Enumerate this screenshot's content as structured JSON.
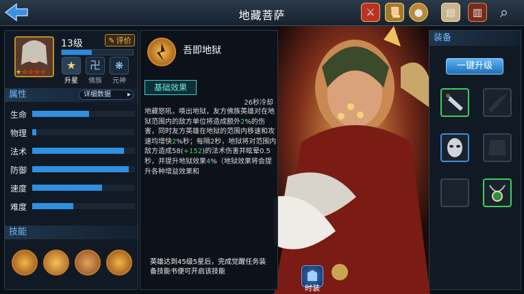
{
  "header": {
    "title": "地藏菩萨"
  },
  "hero": {
    "level": "13级",
    "rate_label": "评价",
    "exp_progress": 0.42,
    "stars_filled": 1,
    "stars_total": 5,
    "mini_buttons": [
      {
        "label": "升星",
        "icon": "star-upgrade-icon"
      },
      {
        "label": "佛族",
        "icon": "buddha-clan-icon"
      },
      {
        "label": "元神",
        "icon": "spirit-icon"
      }
    ]
  },
  "attributes": {
    "title": "属性",
    "detail_label": "详细数据",
    "stats": [
      {
        "label": "生命",
        "value": 0.55
      },
      {
        "label": "物理",
        "value": 0.04
      },
      {
        "label": "法术",
        "value": 0.89
      },
      {
        "label": "防御",
        "value": 0.94
      },
      {
        "label": "速度",
        "value": 0.68
      },
      {
        "label": "难度",
        "value": 0.4
      }
    ]
  },
  "skills_section": {
    "title": "技能"
  },
  "skill_detail": {
    "name": "吾即地狱",
    "tab": "基础效果",
    "cooldown": "26秒冷却",
    "desc_parts": [
      {
        "t": "地藏怒吼，唤出地狱，友方佛族英雄对在地狱范围内的敌方单位将造成额外"
      },
      {
        "t": "2",
        "hl": true
      },
      {
        "t": "%的伤害，同时友方英雄在地狱的范围内移速和攻速均增快"
      },
      {
        "t": "2",
        "hl": true
      },
      {
        "t": "%秒；每隔2秒，地狱将对范围内敌方造成58("
      },
      {
        "t": "+152",
        "hl": true
      },
      {
        "t": ")的法术伤害并眩晕0.5秒，并提升地狱效果"
      },
      {
        "t": "4",
        "hl": true
      },
      {
        "t": "%（地狱效果将会提升各种增益效果和"
      }
    ],
    "requirement": "英雄达到45级5星后，完成觉醒任务装备技能书便可开启该技能"
  },
  "equipment": {
    "title": "装备",
    "upgrade_label": "一键升级",
    "slots": [
      {
        "name": "dagger-equip",
        "state": "green"
      },
      {
        "name": "empty-weapon-slot",
        "state": "empty"
      },
      {
        "name": "mask-equip",
        "state": "blue"
      },
      {
        "name": "empty-armor-slot",
        "state": "empty"
      },
      {
        "name": "empty-slot",
        "state": "empty"
      },
      {
        "name": "amulet-equip",
        "state": "green"
      }
    ]
  },
  "bottom": {
    "costume_label": "时装"
  },
  "colors": {
    "accent": "#2f8fe0",
    "highlight": "#4bd96b",
    "teal": "#3fd3c6",
    "gold": "#c98a2e"
  }
}
